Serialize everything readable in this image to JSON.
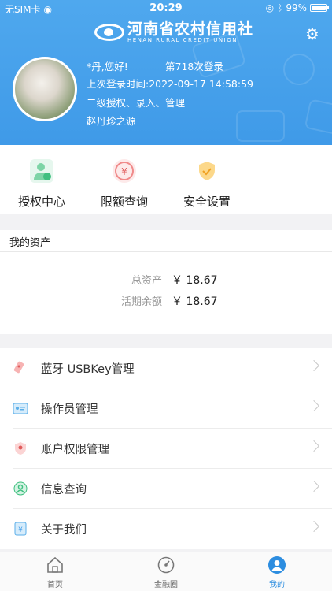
{
  "statusbar": {
    "carrier": "无SIM卡",
    "time": "20:29",
    "battery": "99%",
    "battery_level": 0.99
  },
  "header": {
    "logo_cn": "河南省农村信用社",
    "logo_en": "HENAN RURAL CREDIT UNION"
  },
  "user": {
    "greeting": "*丹,您好!",
    "login_count": "第718次登录",
    "last_login": "上次登录时间:2022-09-17 14:58:59",
    "role": "二级授权、录入、管理",
    "org": "赵丹珍之源"
  },
  "quick_actions": [
    {
      "label": "授权中心",
      "icon": "authorization-center-icon"
    },
    {
      "label": "限额查询",
      "icon": "limit-query-icon"
    },
    {
      "label": "安全设置",
      "icon": "security-settings-icon"
    }
  ],
  "assets": {
    "title": "我的资产",
    "total_label": "总资产",
    "total_value": "￥ 18.67",
    "balance_label": "活期余额",
    "balance_value": "￥ 18.67"
  },
  "menu": [
    {
      "label": "蓝牙 USBKey管理",
      "icon": "usbkey-icon"
    },
    {
      "label": "操作员管理",
      "icon": "operator-card-icon"
    },
    {
      "label": "账户权限管理",
      "icon": "account-permission-icon"
    },
    {
      "label": "信息查询",
      "icon": "info-query-icon"
    },
    {
      "label": "关于我们",
      "icon": "about-us-icon"
    }
  ],
  "tabs": [
    {
      "label": "首页",
      "icon": "home-icon"
    },
    {
      "label": "金融圈",
      "icon": "finance-circle-icon"
    },
    {
      "label": "我的",
      "icon": "profile-icon",
      "active": true
    }
  ],
  "colors": {
    "brand": "#3f9ae8",
    "active_tab": "#2c8de0"
  }
}
